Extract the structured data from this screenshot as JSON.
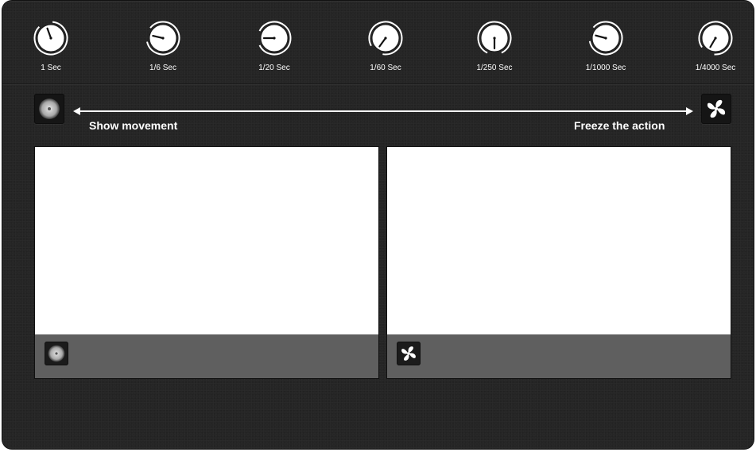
{
  "shutter_speeds": [
    {
      "label": "1 Sec",
      "pointer_angle_deg": -20
    },
    {
      "label": "1/6 Sec",
      "pointer_angle_deg": -77
    },
    {
      "label": "1/20 Sec",
      "pointer_angle_deg": -90
    },
    {
      "label": "1/60 Sec",
      "pointer_angle_deg": 216
    },
    {
      "label": "1/250 Sec",
      "pointer_angle_deg": 180
    },
    {
      "label": "1/1000 Sec",
      "pointer_angle_deg": -75
    },
    {
      "label": "1/4000 Sec",
      "pointer_angle_deg": 210
    }
  ],
  "movement_scale": {
    "left_label": "Show movement",
    "right_label": "Freeze the action",
    "left_icon": "spinning-blur-icon",
    "right_icon": "fan-icon"
  },
  "panels": [
    {
      "name": "slow-shutter-example",
      "icon": "spinning-blur-icon"
    },
    {
      "name": "fast-shutter-example",
      "icon": "fan-icon"
    }
  ],
  "colors": {
    "background": "#252525",
    "caption_bar": "#5f5f5f",
    "text": "#ffffff"
  }
}
